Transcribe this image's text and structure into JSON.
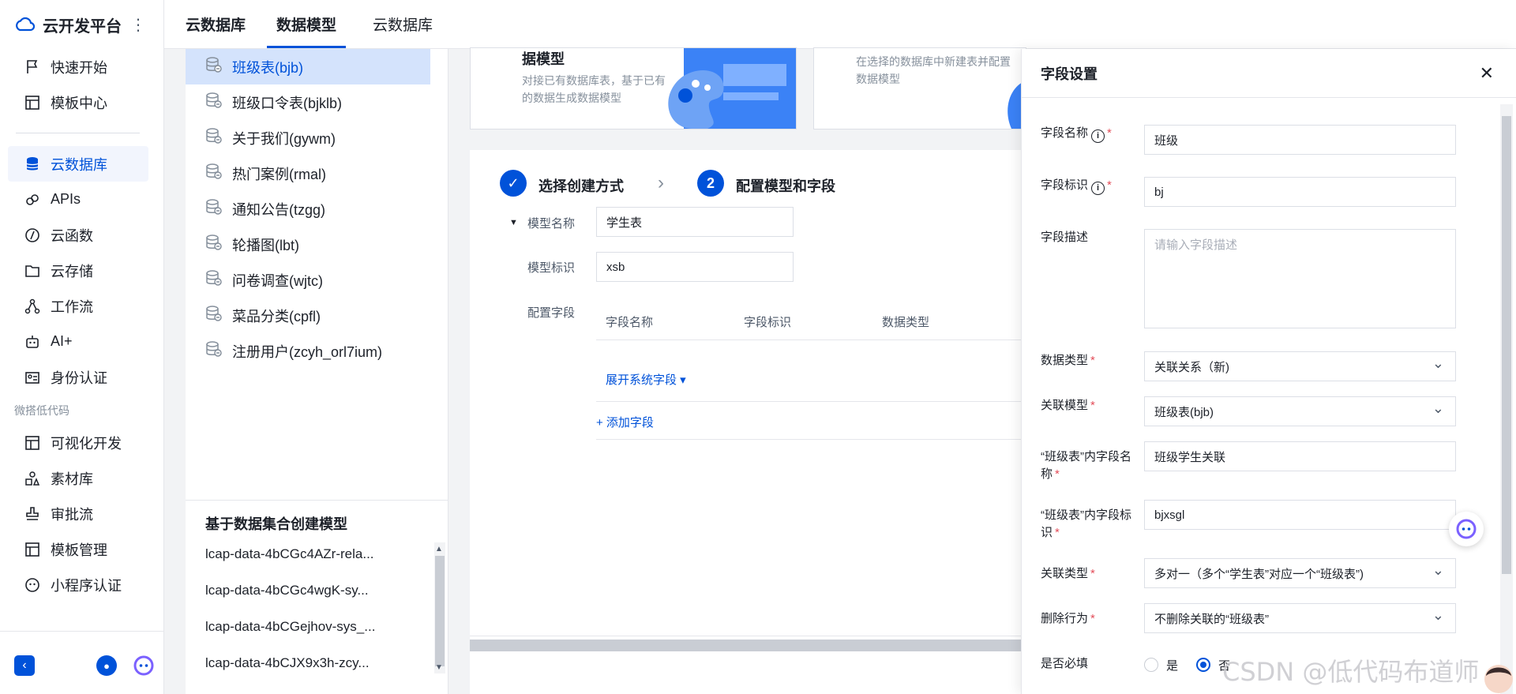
{
  "app": {
    "title": "云开发平台"
  },
  "nav": {
    "items": [
      {
        "label": "快速开始",
        "icon": "flag-icon"
      },
      {
        "label": "模板中心",
        "icon": "template-icon"
      }
    ],
    "main_items": [
      {
        "label": "云数据库",
        "icon": "database-icon",
        "active": true
      },
      {
        "label": "APIs",
        "icon": "link-icon"
      },
      {
        "label": "云函数",
        "icon": "function-icon"
      },
      {
        "label": "云存储",
        "icon": "folder-icon"
      },
      {
        "label": "工作流",
        "icon": "workflow-icon"
      },
      {
        "label": "AI+",
        "icon": "robot-icon"
      },
      {
        "label": "身份认证",
        "icon": "id-card-icon"
      }
    ],
    "group_label": "微搭低代码",
    "lowcode_items": [
      {
        "label": "可视化开发",
        "icon": "layout-icon"
      },
      {
        "label": "素材库",
        "icon": "assets-icon"
      },
      {
        "label": "审批流",
        "icon": "stamp-icon"
      },
      {
        "label": "模板管理",
        "icon": "template-manage-icon"
      },
      {
        "label": "小程序认证",
        "icon": "miniprogram-icon"
      }
    ]
  },
  "topbar": {
    "crumb": "云数据库",
    "tabs": [
      {
        "label": "数据模型",
        "active": true
      },
      {
        "label": "云数据库",
        "active": false
      }
    ]
  },
  "tables": [
    {
      "label": "班级表(bjb)",
      "active": true
    },
    {
      "label": "班级口令表(bjklb)"
    },
    {
      "label": "关于我们(gywm)"
    },
    {
      "label": "热门案例(rmal)"
    },
    {
      "label": "通知公告(tzgg)"
    },
    {
      "label": "轮播图(lbt)"
    },
    {
      "label": "问卷调查(wjtc)"
    },
    {
      "label": "菜品分类(cpfl)"
    },
    {
      "label": "注册用户(zcyh_orl7ium)"
    }
  ],
  "dataset_section": {
    "title": "基于数据集合创建模型",
    "items": [
      "lcap-data-4bCGc4AZr-rela...",
      "lcap-data-4bCGc4wgK-sy...",
      "lcap-data-4bCGejhov-sys_...",
      "lcap-data-4bCJX9x3h-zcy..."
    ]
  },
  "cards": [
    {
      "title": "据模型",
      "desc": "对接已有数据库表，基于已有的数据生成数据模型"
    },
    {
      "title": "",
      "desc": "在选择的数据库中新建表并配置数据模型"
    }
  ],
  "steps": [
    {
      "index": "✓",
      "label": "选择创建方式"
    },
    {
      "index": "2",
      "label": "配置模型和字段"
    }
  ],
  "model_form": {
    "name_label": "模型名称",
    "name_value": "学生表",
    "id_label": "模型标识",
    "id_value": "xsb",
    "fields_label": "配置字段",
    "columns": [
      "字段名称",
      "字段标识",
      "数据类型"
    ],
    "expand_system": "展开系统字段 ▾",
    "add_field": "+ 添加字段"
  },
  "drawer": {
    "title": "字段设置",
    "field_name_label": "字段名称",
    "field_name_value": "班级",
    "field_id_label": "字段标识",
    "field_id_value": "bj",
    "field_desc_label": "字段描述",
    "field_desc_placeholder": "请输入字段描述",
    "data_type_label": "数据类型",
    "data_type_value": "关联关系（新)",
    "rel_model_label": "关联模型",
    "rel_model_value": "班级表(bjb)",
    "inner_name_label": "“班级表”内字段名称",
    "inner_name_value": "班级学生关联",
    "inner_id_label": "“班级表”内字段标识",
    "inner_id_value": "bjxsgl",
    "rel_type_label": "关联类型",
    "rel_type_value": "多对一（多个“学生表”对应一个“班级表”)",
    "delete_label": "删除行为",
    "delete_value": "不删除关联的“班级表”",
    "required_label": "是否必填",
    "required_yes": "是",
    "required_no": "否"
  },
  "watermark": "CSDN @低代码布道师",
  "colors": {
    "primary": "#0052d9",
    "required": "#e34d59"
  }
}
